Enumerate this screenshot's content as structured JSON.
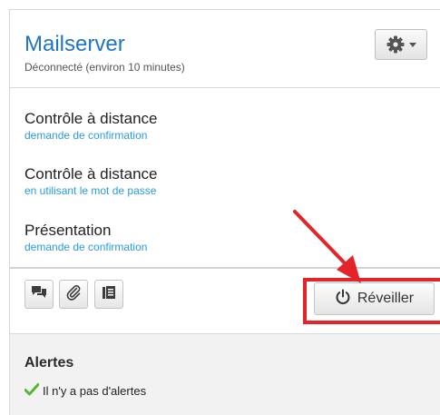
{
  "device": {
    "name": "Mailserver",
    "status": "Déconnecté (environ 10 minutes)"
  },
  "settings": {
    "icon": "gear-icon"
  },
  "actions": [
    {
      "title": "Contrôle à distance",
      "subtitle": "demande de confirmation"
    },
    {
      "title": "Contrôle à distance",
      "subtitle": "en utilisant le mot de passe"
    },
    {
      "title": "Présentation",
      "subtitle": "demande de confirmation"
    }
  ],
  "toolbar": {
    "tools": [
      "chat-icon",
      "attachment-icon",
      "notes-icon"
    ],
    "wake_label": "Réveiller"
  },
  "alerts": {
    "title": "Alertes",
    "empty_message": "Il n'y a pas d'alertes"
  },
  "colors": {
    "title_blue": "#1f75c4",
    "link_blue": "#2a9ae0",
    "highlight_red": "#e3242b",
    "check_green": "#58b536"
  }
}
